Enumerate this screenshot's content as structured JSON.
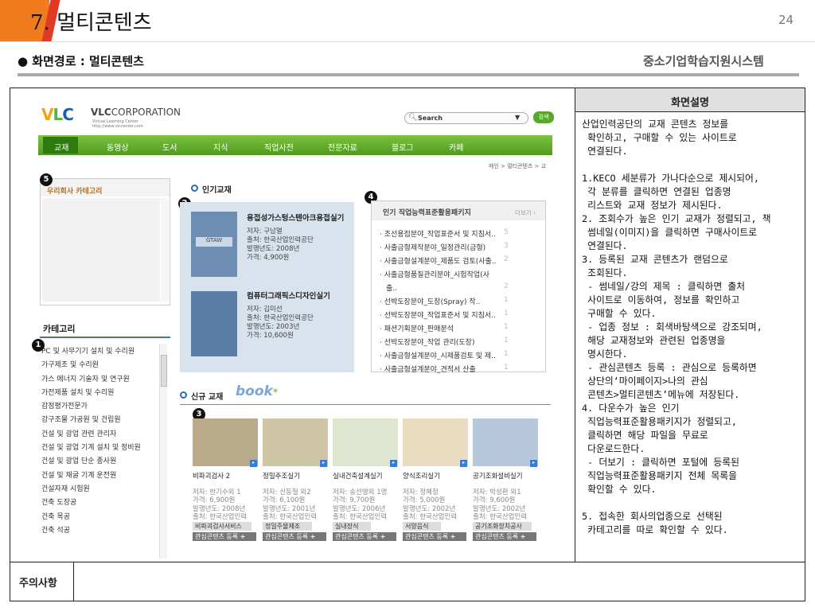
{
  "slide": {
    "number_prefix": "7.",
    "title": "멀티콘텐츠",
    "page": "24",
    "path": "● 화면경로 : 멀티콘텐츠",
    "system": "중소기업학습지원시스템"
  },
  "description": {
    "header": "화면설명",
    "body": "산업인력공단의 교재 콘텐츠 정보를\n 확인하고, 구매할 수 있는 사이트로\n 연결된다.\n\n1.KECO 세분류가 가나다순으로 제시되어,\n 각 분류를 클릭하면 연결된 업종명\n 리스트와 교재 정보가 제시된다.\n2. 조회수가 높은 인기 교재가 정렬되고, 책\n 썸네일(이미지)을 클릭하면 구매사이트로\n 연결된다.\n3. 등록된 교재 콘텐츠가 랜덤으로\n 조회된다.\n - 썸네일/강의 제목 : 클릭하면 출처\n 사이트로 이동하여, 정보를 확인하고\n 구매할 수 있다.\n - 업종 정보 : 회색바탕색으로 강조되며,\n 해당 교재정보와 관련된 업종명을\n 명시한다.\n - 관심콘텐츠 등록 : 관심으로 등록하면\n 상단의‘마이페이지>나의 관심\n 콘텐츠>멀티콘텐츠’메뉴에 저장된다.\n4. 다운수가 높은 인기\n 직업능력표준활용패키지가 정렬되고,\n 클릭하면 해당 파일을 무료로\n 다운로드한다.\n - 더보기 : 클릭하면 포털에 등록된\n 직업능력표준활용패키지 전체 목록을\n 확인할 수 있다.\n\n5. 접속한 회사의업종으로 선택된\n 카테고리를 따로 확인할 수 있다."
  },
  "caution": {
    "label": "주의사항",
    "text": ""
  },
  "site": {
    "logo": {
      "v": "V",
      "l": "L",
      "c": "C",
      "corp": "VLC",
      "corp_suffix": "CORPORATION",
      "tagline": "Virtual Learning Center",
      "url": "http://www.vlccenter.com"
    },
    "search_placeholder": "Search",
    "search_button": "검색",
    "menu": [
      "교재",
      "동영상",
      "도서",
      "지식",
      "직업사전",
      "전문자료",
      "블로그",
      "카페"
    ],
    "breadcrumb": "메인 > 멀티콘텐츠 > 교",
    "company_category_title": "우리회사 카테고리",
    "category_title": "카테고리",
    "categories": [
      "PC 및 사무기기 설치 및 수리원",
      "가구제조 및 수리원",
      "가스 에너지 기술자 및 연구원",
      "가전제품 설치 및 수리원",
      "감정평가전문가",
      "강구조물 가공원 및 건립원",
      "건설 및 광업 관련 관리자",
      "건설 및 광업 기계 설치 및 정비원",
      "건설 및 광업 단순 종사원",
      "건설 및 채굴 기계 운전원",
      "건설자재 시험원",
      "건축 도장공",
      "건축 목공",
      "건축 석공"
    ],
    "popular_title": "인기교재",
    "popular": [
      {
        "title": "용접성가스텅스텐아크용접실기",
        "cover": "GTAW",
        "author": "저자: 구남열",
        "source": "출처: 한국산업인력공단",
        "year": "발행년도: 2008년",
        "price": "가격: 4,900원"
      },
      {
        "title": "컴퓨터그래픽스디자인실기",
        "author": "저자: 김미선",
        "source": "출처: 한국산업인력공단",
        "year": "발행년도: 2003년",
        "price": "가격: 10,600원"
      }
    ],
    "package_title": "인기 직업능력표준활용패키지",
    "package_more": "더보기",
    "packages": [
      {
        "text": "· 조선용접분야_작업표준서 및 지침서..",
        "count": "5"
      },
      {
        "text": "· 사출금형제작분야_일정관리(금형)",
        "count": "3"
      },
      {
        "text": "· 사출금형설계분야_제품도 검토(사출..",
        "count": "2"
      },
      {
        "text": "· 사출금형품질관리분야_시험작업(사",
        "count": ""
      },
      {
        "text": "출..",
        "count": "2"
      },
      {
        "text": "· 선박도장분야_도장(Spray) 작..",
        "count": "1"
      },
      {
        "text": "· 선박도장분야_작업표준서 및 지침서..",
        "count": "1"
      },
      {
        "text": "· 패션기획분야_판매분석",
        "count": "1"
      },
      {
        "text": "· 선박도장분야_작업 관리(도장)",
        "count": "1"
      },
      {
        "text": "· 사출금형설계분야_시제품검토 및 제..",
        "count": "1"
      },
      {
        "text": "· 사출금형설계분야_견적서 산출",
        "count": "1"
      }
    ],
    "new_title": "신규 교재",
    "new_logo": "book",
    "new_books": [
      {
        "title": "비파괴검사 2",
        "author": "저자: 한기수외 1",
        "price": "가격: 6,900원",
        "year": "발행년도: 2008년",
        "source": "출처: 한국산업인력",
        "tag": "비파괴검사서비스",
        "fav": "관심콘텐츠 등록"
      },
      {
        "title": "정밀주조실기",
        "author": "저자: 신동철 외2",
        "price": "가격: 6,100원",
        "year": "발행년도: 2001년",
        "source": "출처: 한국산업인력",
        "tag": "정밀주물제조",
        "fav": "관심콘텐츠 등록"
      },
      {
        "title": "실내건축설계실기",
        "author": "저자: 송선영외 1명",
        "price": "가격: 9,700원",
        "year": "발행년도: 2006년",
        "source": "출처: 한국산업인력",
        "tag": "실내장식",
        "fav": "관심콘텐츠 등록"
      },
      {
        "title": "양식조리실기",
        "author": "저자: 정혜정",
        "price": "가격: 5,000원",
        "year": "발행년도: 2002년",
        "source": "출처: 한국산업인력",
        "tag": "서양음식",
        "fav": "관심콘텐츠 등록"
      },
      {
        "title": "공기조화설비실기",
        "author": "저자: 박성환 외1",
        "price": "가격: 9,600원",
        "year": "발행년도: 2002년",
        "source": "출처: 한국산업인력",
        "tag": "공기조화장치공사",
        "fav": "관심콘텐츠 등록"
      }
    ],
    "badges": [
      "1",
      "2",
      "3",
      "4",
      "5"
    ]
  },
  "colors": {
    "menu_green": "#5aa82a",
    "accent_orange": "#f07c1e",
    "accent_red": "#e23a24",
    "header_gray": "#e0e0e0"
  }
}
